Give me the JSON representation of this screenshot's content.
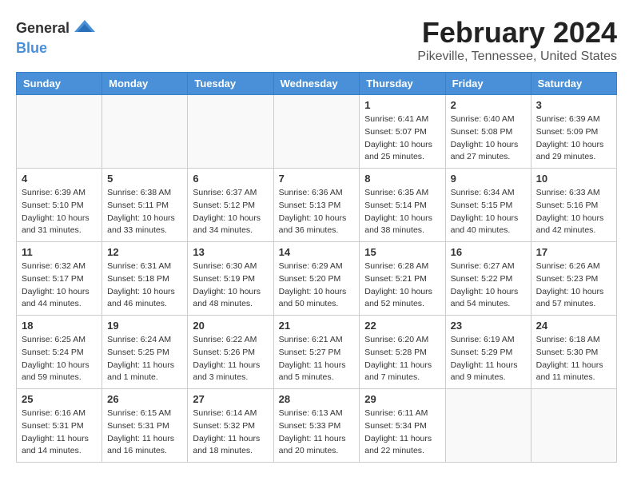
{
  "logo": {
    "text_general": "General",
    "text_blue": "Blue"
  },
  "title": "February 2024",
  "subtitle": "Pikeville, Tennessee, United States",
  "days_of_week": [
    "Sunday",
    "Monday",
    "Tuesday",
    "Wednesday",
    "Thursday",
    "Friday",
    "Saturday"
  ],
  "weeks": [
    [
      {
        "day": "",
        "info": ""
      },
      {
        "day": "",
        "info": ""
      },
      {
        "day": "",
        "info": ""
      },
      {
        "day": "",
        "info": ""
      },
      {
        "day": "1",
        "info": "Sunrise: 6:41 AM\nSunset: 5:07 PM\nDaylight: 10 hours\nand 25 minutes."
      },
      {
        "day": "2",
        "info": "Sunrise: 6:40 AM\nSunset: 5:08 PM\nDaylight: 10 hours\nand 27 minutes."
      },
      {
        "day": "3",
        "info": "Sunrise: 6:39 AM\nSunset: 5:09 PM\nDaylight: 10 hours\nand 29 minutes."
      }
    ],
    [
      {
        "day": "4",
        "info": "Sunrise: 6:39 AM\nSunset: 5:10 PM\nDaylight: 10 hours\nand 31 minutes."
      },
      {
        "day": "5",
        "info": "Sunrise: 6:38 AM\nSunset: 5:11 PM\nDaylight: 10 hours\nand 33 minutes."
      },
      {
        "day": "6",
        "info": "Sunrise: 6:37 AM\nSunset: 5:12 PM\nDaylight: 10 hours\nand 34 minutes."
      },
      {
        "day": "7",
        "info": "Sunrise: 6:36 AM\nSunset: 5:13 PM\nDaylight: 10 hours\nand 36 minutes."
      },
      {
        "day": "8",
        "info": "Sunrise: 6:35 AM\nSunset: 5:14 PM\nDaylight: 10 hours\nand 38 minutes."
      },
      {
        "day": "9",
        "info": "Sunrise: 6:34 AM\nSunset: 5:15 PM\nDaylight: 10 hours\nand 40 minutes."
      },
      {
        "day": "10",
        "info": "Sunrise: 6:33 AM\nSunset: 5:16 PM\nDaylight: 10 hours\nand 42 minutes."
      }
    ],
    [
      {
        "day": "11",
        "info": "Sunrise: 6:32 AM\nSunset: 5:17 PM\nDaylight: 10 hours\nand 44 minutes."
      },
      {
        "day": "12",
        "info": "Sunrise: 6:31 AM\nSunset: 5:18 PM\nDaylight: 10 hours\nand 46 minutes."
      },
      {
        "day": "13",
        "info": "Sunrise: 6:30 AM\nSunset: 5:19 PM\nDaylight: 10 hours\nand 48 minutes."
      },
      {
        "day": "14",
        "info": "Sunrise: 6:29 AM\nSunset: 5:20 PM\nDaylight: 10 hours\nand 50 minutes."
      },
      {
        "day": "15",
        "info": "Sunrise: 6:28 AM\nSunset: 5:21 PM\nDaylight: 10 hours\nand 52 minutes."
      },
      {
        "day": "16",
        "info": "Sunrise: 6:27 AM\nSunset: 5:22 PM\nDaylight: 10 hours\nand 54 minutes."
      },
      {
        "day": "17",
        "info": "Sunrise: 6:26 AM\nSunset: 5:23 PM\nDaylight: 10 hours\nand 57 minutes."
      }
    ],
    [
      {
        "day": "18",
        "info": "Sunrise: 6:25 AM\nSunset: 5:24 PM\nDaylight: 10 hours\nand 59 minutes."
      },
      {
        "day": "19",
        "info": "Sunrise: 6:24 AM\nSunset: 5:25 PM\nDaylight: 11 hours\nand 1 minute."
      },
      {
        "day": "20",
        "info": "Sunrise: 6:22 AM\nSunset: 5:26 PM\nDaylight: 11 hours\nand 3 minutes."
      },
      {
        "day": "21",
        "info": "Sunrise: 6:21 AM\nSunset: 5:27 PM\nDaylight: 11 hours\nand 5 minutes."
      },
      {
        "day": "22",
        "info": "Sunrise: 6:20 AM\nSunset: 5:28 PM\nDaylight: 11 hours\nand 7 minutes."
      },
      {
        "day": "23",
        "info": "Sunrise: 6:19 AM\nSunset: 5:29 PM\nDaylight: 11 hours\nand 9 minutes."
      },
      {
        "day": "24",
        "info": "Sunrise: 6:18 AM\nSunset: 5:30 PM\nDaylight: 11 hours\nand 11 minutes."
      }
    ],
    [
      {
        "day": "25",
        "info": "Sunrise: 6:16 AM\nSunset: 5:31 PM\nDaylight: 11 hours\nand 14 minutes."
      },
      {
        "day": "26",
        "info": "Sunrise: 6:15 AM\nSunset: 5:31 PM\nDaylight: 11 hours\nand 16 minutes."
      },
      {
        "day": "27",
        "info": "Sunrise: 6:14 AM\nSunset: 5:32 PM\nDaylight: 11 hours\nand 18 minutes."
      },
      {
        "day": "28",
        "info": "Sunrise: 6:13 AM\nSunset: 5:33 PM\nDaylight: 11 hours\nand 20 minutes."
      },
      {
        "day": "29",
        "info": "Sunrise: 6:11 AM\nSunset: 5:34 PM\nDaylight: 11 hours\nand 22 minutes."
      },
      {
        "day": "",
        "info": ""
      },
      {
        "day": "",
        "info": ""
      }
    ]
  ]
}
